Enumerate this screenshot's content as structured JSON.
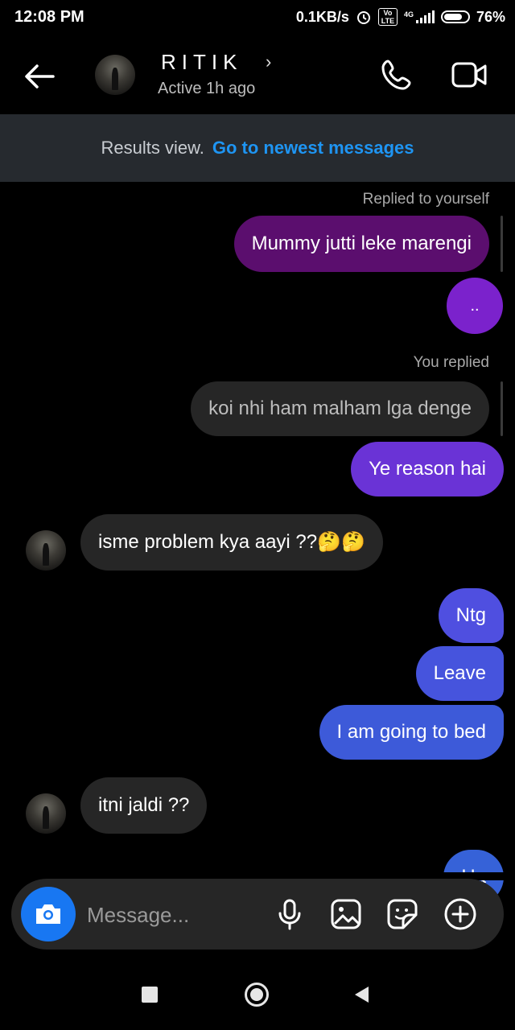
{
  "status_bar": {
    "time": "12:08 PM",
    "network_speed": "0.1KB/s",
    "network_type": "4G",
    "volte": "Vo LTE",
    "battery": "76%"
  },
  "header": {
    "name": "RITIK",
    "activity": "Active 1h ago",
    "chevron": "›"
  },
  "banner": {
    "label": "Results view.",
    "link": "Go to newest messages"
  },
  "messages": {
    "m1_meta": "Replied to yourself",
    "m1_text": "Mummy jutti leke marengi",
    "m2_text": "..",
    "m3_meta": "You replied",
    "m3_quote": "koi nhi ham malham lga denge",
    "m4_text": "Ye reason hai",
    "m5_text": "isme problem kya aayi ??🤔🤔",
    "m6_text": "Ntg",
    "m7_text": "Leave",
    "m8_text": "I am going to bed",
    "m9_text": "itni jaldi ??",
    "m10_text": "Ha"
  },
  "composer": {
    "placeholder": "Message..."
  },
  "colors": {
    "accent_blue": "#1877f2",
    "link_blue": "#1e95f3",
    "bubble_purple_dark": "#5b0e6e",
    "bubble_purple": "#7b22cc",
    "bubble_indigo": "#6a33d6",
    "bubble_blue": "#3d5ad9",
    "incoming": "#262626"
  },
  "icons": [
    "back-arrow-icon",
    "phone-icon",
    "video-camera-icon",
    "camera-icon",
    "microphone-icon",
    "gallery-icon",
    "sticker-icon",
    "plus-circle-icon",
    "nav-recents-icon",
    "nav-home-icon",
    "nav-back-icon"
  ]
}
